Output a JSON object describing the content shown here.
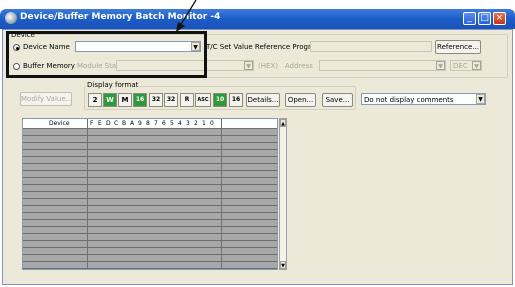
{
  "window": {
    "title": "Device/Buffer Memory Batch Monitor -4",
    "controls": [
      "minimize-icon",
      "maximize-icon",
      "close-icon"
    ]
  },
  "device_group": {
    "label": "Device",
    "device_name_radio": "Device Name",
    "device_name_value": "",
    "buffer_memory_radio": "Buffer Memory",
    "module_start_label": "Module Start",
    "hex_label": "(HEX)",
    "address_label": "Address",
    "dec_value": "DEC",
    "tc_label": "T/C Set Value Reference Program",
    "tc_value": "",
    "reference_button": "Reference..."
  },
  "toolbar": {
    "modify_value_button": "Modify Value...",
    "display_format_label": "Display format",
    "format_buttons": [
      "2",
      "W",
      "M",
      "16",
      "32",
      "32",
      "R",
      "ASC",
      "10",
      "16"
    ],
    "details_button": "Details...",
    "open_button": "Open...",
    "save_button": "Save...",
    "comment_select_value": "Do not display comments"
  },
  "grid": {
    "column_device": "Device",
    "bit_columns": [
      "F",
      "E",
      "D",
      "C",
      "B",
      "A",
      "9",
      "8",
      "7",
      "6",
      "5",
      "4",
      "3",
      "2",
      "1",
      "0"
    ],
    "row_count": 20
  }
}
